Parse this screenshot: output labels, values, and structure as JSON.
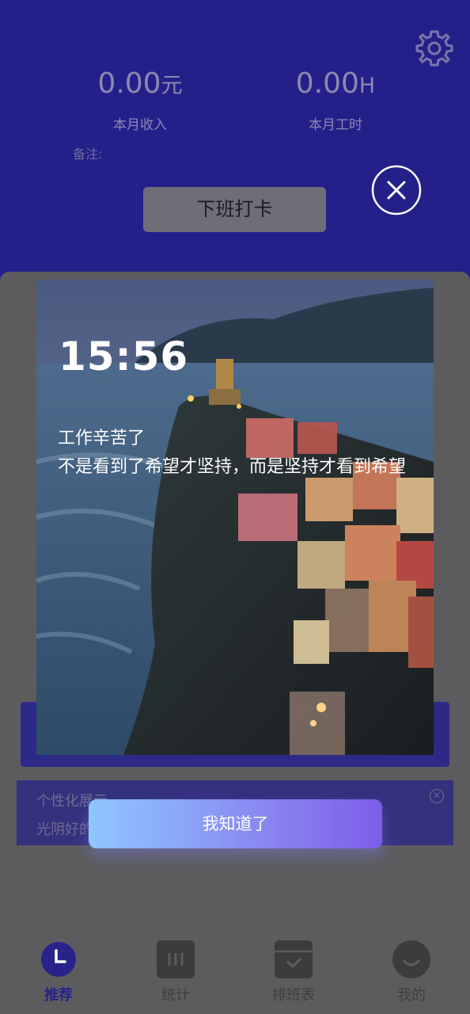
{
  "header": {
    "income_value": "0.00",
    "income_unit": "元",
    "income_label": "本月收入",
    "hours_value": "0.00",
    "hours_unit": "H",
    "hours_label": "本月工时",
    "note_label": "备注:",
    "clock_out_button": "下班打卡"
  },
  "banner": {
    "line1": "个性化展示",
    "line2": "光阴好的"
  },
  "popup": {
    "time": "15:56",
    "message_line1": "工作辛苦了",
    "message_line2": "不是看到了希望才坚持，而是坚持才看到希望",
    "confirm_button": "我知道了"
  },
  "tabs": [
    {
      "label": "推荐",
      "icon": "clock-icon",
      "active": true
    },
    {
      "label": "统计",
      "icon": "chart-icon",
      "active": false
    },
    {
      "label": "排班表",
      "icon": "calendar-icon",
      "active": false
    },
    {
      "label": "我的",
      "icon": "profile-smile-icon",
      "active": false
    }
  ],
  "colors": {
    "header_bg": "#24208a",
    "accent": "#27238a",
    "button_gradient_start": "#8ec7ff",
    "button_gradient_end": "#7e5de8"
  }
}
